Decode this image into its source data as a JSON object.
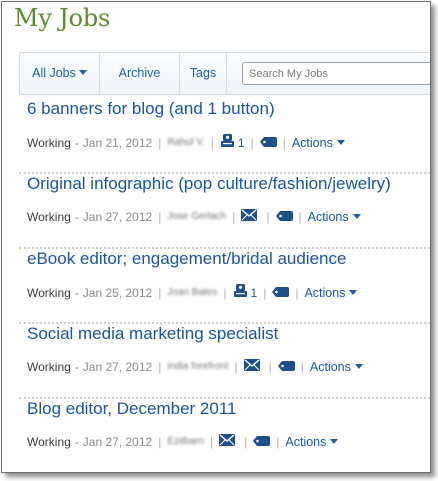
{
  "page": {
    "title": "My Jobs"
  },
  "toolbar": {
    "all_jobs_label": "All Jobs",
    "archive_label": "Archive",
    "tags_label": "Tags",
    "search_placeholder": "Search My Jobs"
  },
  "colors": {
    "title_green": "#5b8d2e",
    "link_blue": "#1a55a3",
    "icon_navy": "#1e4f8f"
  },
  "jobs": [
    {
      "title": "6 banners for blog (and 1 button)",
      "status": "Working",
      "date": "Jan 21, 2012",
      "owner": "Rahul V.",
      "message_icon": "discussion-icon",
      "message_count": "1",
      "actions_label": "Actions"
    },
    {
      "title": "Original infographic (pop culture/fashion/jewelry)",
      "status": "Working",
      "date": "Jan 27, 2012",
      "owner": "Jose Gerlach",
      "message_icon": "envelope-icon",
      "message_count": "",
      "actions_label": "Actions"
    },
    {
      "title": "eBook editor; engagement/bridal audience",
      "status": "Working",
      "date": "Jan 25, 2012",
      "owner": "Joan Bates",
      "message_icon": "discussion-icon",
      "message_count": "1",
      "actions_label": "Actions"
    },
    {
      "title": "Social media marketing specialist",
      "status": "Working",
      "date": "Jan 27, 2012",
      "owner": "india forefront",
      "message_icon": "envelope-icon",
      "message_count": "",
      "actions_label": "Actions"
    },
    {
      "title": "Blog editor, December 2011",
      "status": "Working",
      "date": "Jan 27, 2012",
      "owner": "Ezitbarn",
      "message_icon": "envelope-icon",
      "message_count": "",
      "actions_label": "Actions"
    }
  ]
}
